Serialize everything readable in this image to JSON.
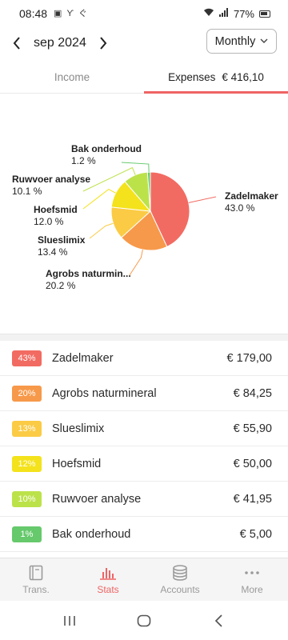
{
  "status": {
    "time": "08:48",
    "battery": "77%"
  },
  "header": {
    "month": "sep 2024",
    "period": "Monthly"
  },
  "tabs": [
    {
      "label": "Income",
      "amount": ""
    },
    {
      "label": "Expenses",
      "amount": "€ 416,10"
    }
  ],
  "chart_data": {
    "type": "pie",
    "slices": [
      {
        "label": "Zadelmaker",
        "pct_label": "43.0 %",
        "value": 43.0,
        "color": "#f26b62"
      },
      {
        "label": "Agrobs naturmin...",
        "pct_label": "20.2 %",
        "value": 20.2,
        "color": "#f7994a"
      },
      {
        "label": "Slueslimix",
        "pct_label": "13.4 %",
        "value": 13.4,
        "color": "#fbcb45"
      },
      {
        "label": "Hoefsmid",
        "pct_label": "12.0 %",
        "value": 12.0,
        "color": "#f4e21c"
      },
      {
        "label": "Ruwvoer analyse",
        "pct_label": "10.1 %",
        "value": 10.1,
        "color": "#bce24a"
      },
      {
        "label": "Bak onderhoud",
        "pct_label": "1.2 %",
        "value": 1.2,
        "color": "#66c96c"
      }
    ]
  },
  "list": [
    {
      "pct": "43%",
      "name": "Zadelmaker",
      "amount": "€ 179,00",
      "color": "#f26b62"
    },
    {
      "pct": "20%",
      "name": "Agrobs naturmineral",
      "amount": "€ 84,25",
      "color": "#f7994a"
    },
    {
      "pct": "13%",
      "name": "Slueslimix",
      "amount": "€ 55,90",
      "color": "#fbcb45"
    },
    {
      "pct": "12%",
      "name": "Hoefsmid",
      "amount": "€ 50,00",
      "color": "#f4e21c"
    },
    {
      "pct": "10%",
      "name": "Ruwvoer analyse",
      "amount": "€ 41,95",
      "color": "#bce24a"
    },
    {
      "pct": "1%",
      "name": "Bak onderhoud",
      "amount": "€ 5,00",
      "color": "#66c96c"
    }
  ],
  "bottom_nav": [
    {
      "label": "Trans.",
      "icon": "book-icon"
    },
    {
      "label": "Stats",
      "icon": "bar-chart-icon"
    },
    {
      "label": "Accounts",
      "icon": "coins-icon"
    },
    {
      "label": "More",
      "icon": "more-dots-icon"
    }
  ],
  "colors": {
    "accent": "#ef6464"
  }
}
